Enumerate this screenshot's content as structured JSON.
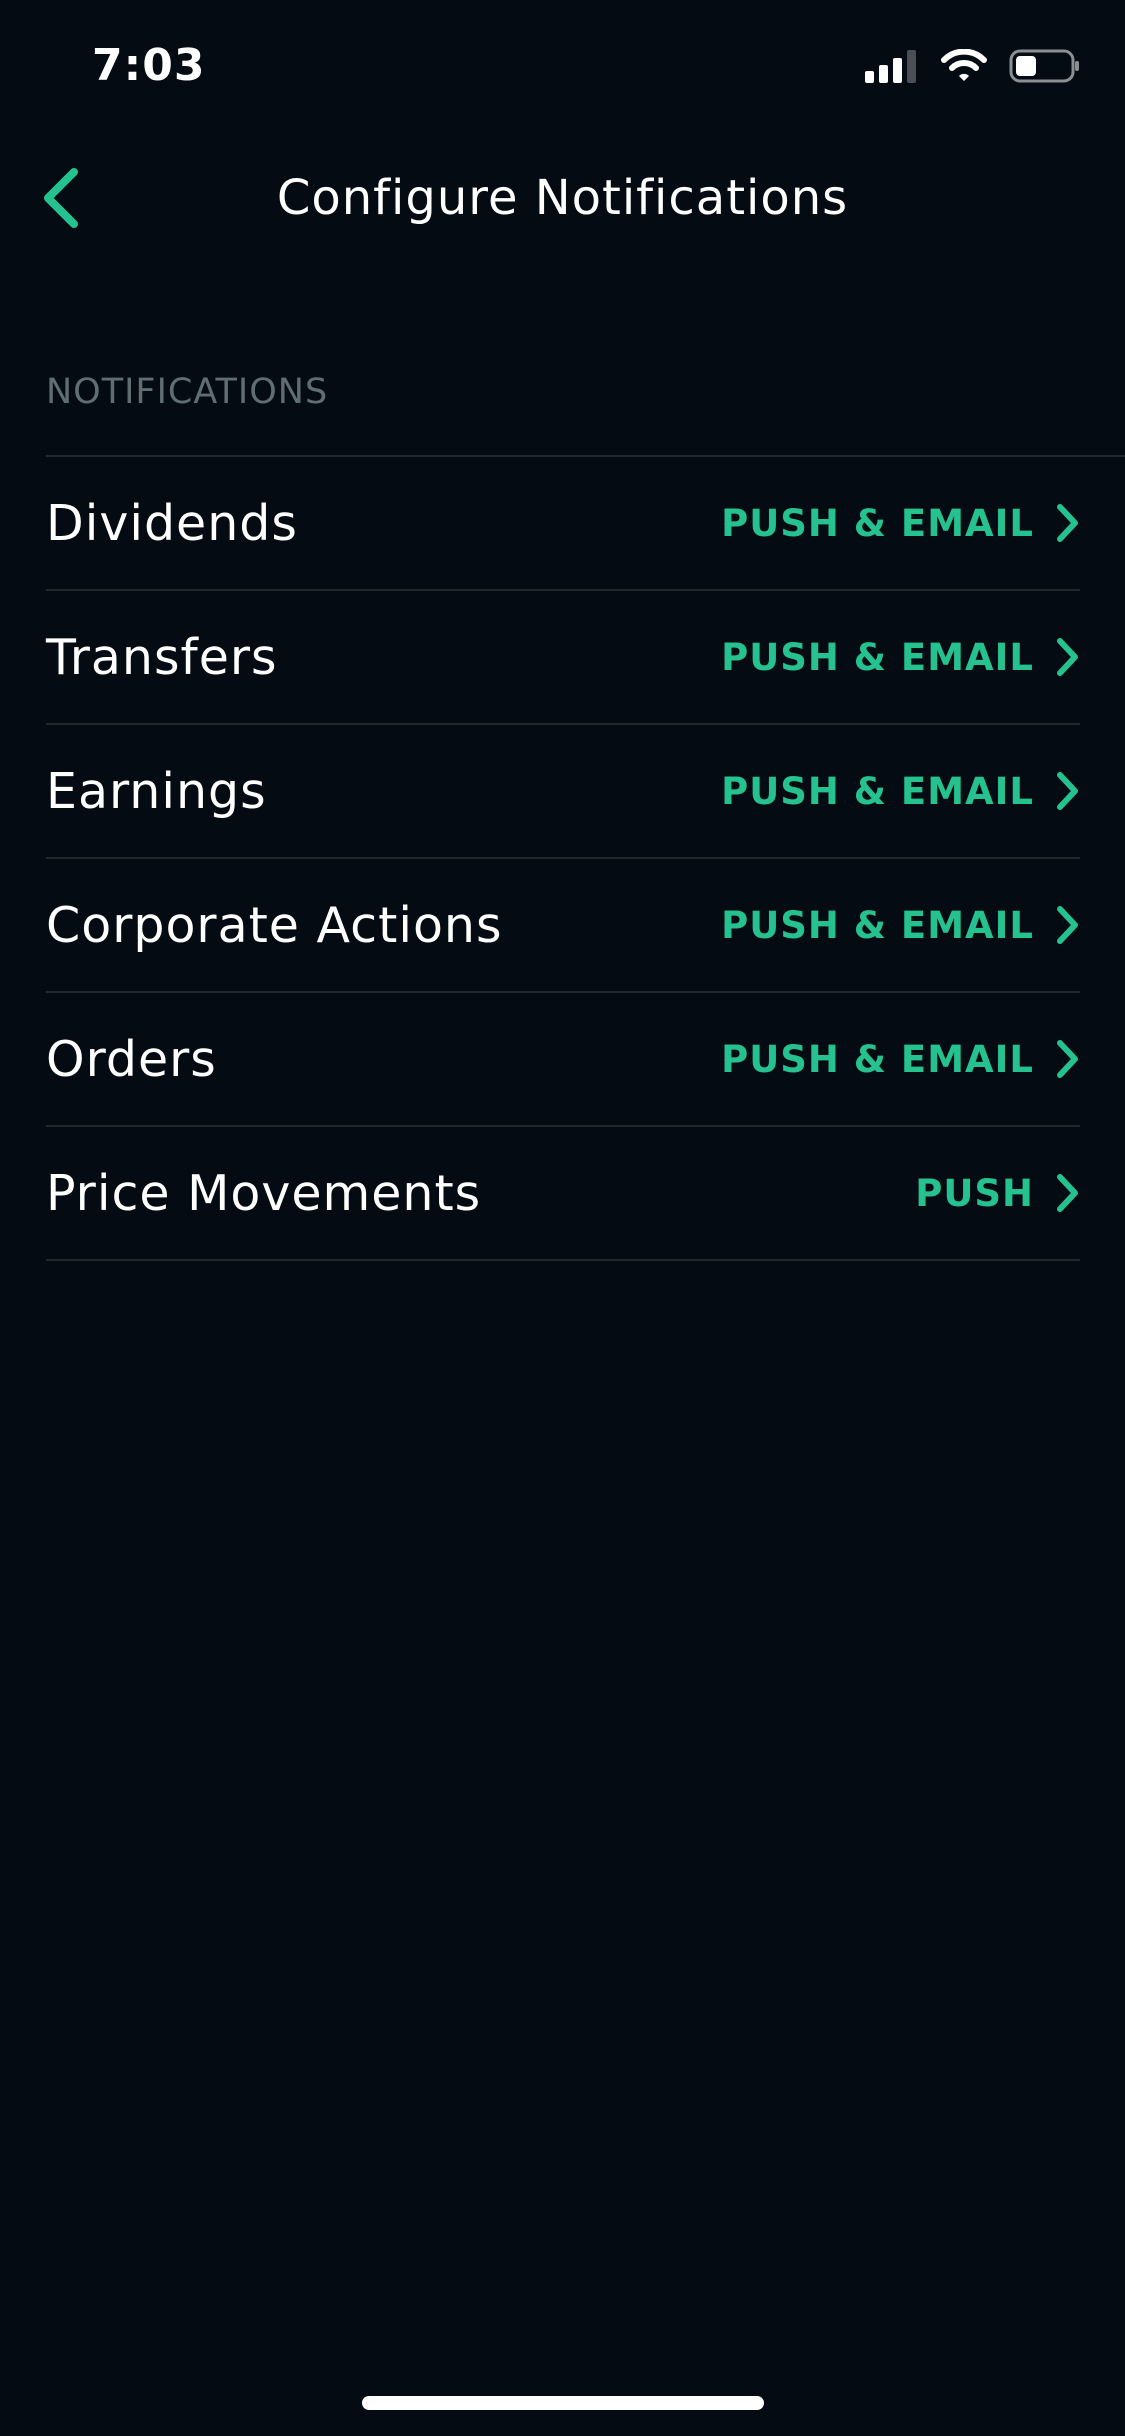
{
  "status_bar": {
    "time": "7:03"
  },
  "nav": {
    "back_icon": "chevron-left-icon",
    "title": "Configure Notifications"
  },
  "section": {
    "header": "NOTIFICATIONS"
  },
  "rows": [
    {
      "label": "Dividends",
      "value": "PUSH & EMAIL"
    },
    {
      "label": "Transfers",
      "value": "PUSH & EMAIL"
    },
    {
      "label": "Earnings",
      "value": "PUSH & EMAIL"
    },
    {
      "label": "Corporate Actions",
      "value": "PUSH & EMAIL"
    },
    {
      "label": "Orders",
      "value": "PUSH & EMAIL"
    },
    {
      "label": "Price Movements",
      "value": "PUSH"
    }
  ],
  "colors": {
    "background": "#050b12",
    "accent": "#25c18f",
    "section_header": "#5f6e72",
    "divider": "#1e2a2e"
  }
}
